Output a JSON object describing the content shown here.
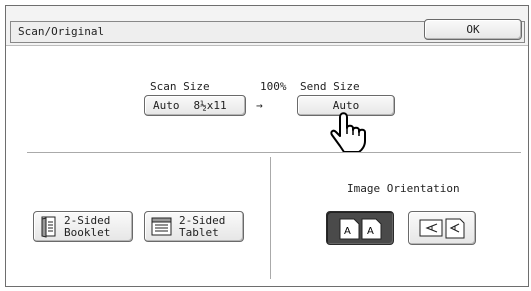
{
  "header": {
    "title": "Scan/Original",
    "ok_label": "OK"
  },
  "scan": {
    "scan_size_label": "Scan Size",
    "scan_size_value": "Auto",
    "scan_size_paper": "8½x11",
    "ratio": "100%",
    "arrow": "→",
    "send_size_label": "Send Size",
    "send_size_value": "Auto"
  },
  "duplex": {
    "booklet_label_1": "2-Sided",
    "booklet_label_2": "Booklet",
    "tablet_label_1": "2-Sided",
    "tablet_label_2": "Tablet"
  },
  "orientation": {
    "label": "Image Orientation",
    "selected": "upright"
  },
  "colors": {
    "selected_bg": "#4a4a4a",
    "panel_border": "#6e6e6e"
  }
}
